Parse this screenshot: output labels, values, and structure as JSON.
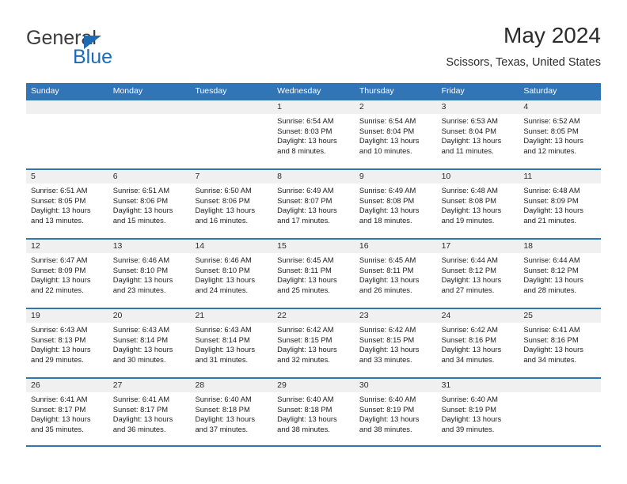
{
  "brand": {
    "name_part1": "General",
    "name_part2": "Blue",
    "triangle_color": "#1b6cb5"
  },
  "header": {
    "title": "May 2024",
    "location": "Scissors, Texas, United States"
  },
  "theme": {
    "header_blue": "#3275b7",
    "date_band_gray": "#f0f0f0",
    "text_color": "#1c1c1c"
  },
  "weekdays": [
    "Sunday",
    "Monday",
    "Tuesday",
    "Wednesday",
    "Thursday",
    "Friday",
    "Saturday"
  ],
  "labels": {
    "sunrise_prefix": "Sunrise:",
    "sunset_prefix": "Sunset:",
    "daylight_prefix": "Daylight:"
  },
  "weeks": [
    [
      {
        "day": "",
        "empty": true
      },
      {
        "day": "",
        "empty": true
      },
      {
        "day": "",
        "empty": true
      },
      {
        "day": "1",
        "sunrise": "Sunrise: 6:54 AM",
        "sunset": "Sunset: 8:03 PM",
        "daylight_a": "Daylight: 13 hours",
        "daylight_b": "and 8 minutes."
      },
      {
        "day": "2",
        "sunrise": "Sunrise: 6:54 AM",
        "sunset": "Sunset: 8:04 PM",
        "daylight_a": "Daylight: 13 hours",
        "daylight_b": "and 10 minutes."
      },
      {
        "day": "3",
        "sunrise": "Sunrise: 6:53 AM",
        "sunset": "Sunset: 8:04 PM",
        "daylight_a": "Daylight: 13 hours",
        "daylight_b": "and 11 minutes."
      },
      {
        "day": "4",
        "sunrise": "Sunrise: 6:52 AM",
        "sunset": "Sunset: 8:05 PM",
        "daylight_a": "Daylight: 13 hours",
        "daylight_b": "and 12 minutes."
      }
    ],
    [
      {
        "day": "5",
        "sunrise": "Sunrise: 6:51 AM",
        "sunset": "Sunset: 8:05 PM",
        "daylight_a": "Daylight: 13 hours",
        "daylight_b": "and 13 minutes."
      },
      {
        "day": "6",
        "sunrise": "Sunrise: 6:51 AM",
        "sunset": "Sunset: 8:06 PM",
        "daylight_a": "Daylight: 13 hours",
        "daylight_b": "and 15 minutes."
      },
      {
        "day": "7",
        "sunrise": "Sunrise: 6:50 AM",
        "sunset": "Sunset: 8:06 PM",
        "daylight_a": "Daylight: 13 hours",
        "daylight_b": "and 16 minutes."
      },
      {
        "day": "8",
        "sunrise": "Sunrise: 6:49 AM",
        "sunset": "Sunset: 8:07 PM",
        "daylight_a": "Daylight: 13 hours",
        "daylight_b": "and 17 minutes."
      },
      {
        "day": "9",
        "sunrise": "Sunrise: 6:49 AM",
        "sunset": "Sunset: 8:08 PM",
        "daylight_a": "Daylight: 13 hours",
        "daylight_b": "and 18 minutes."
      },
      {
        "day": "10",
        "sunrise": "Sunrise: 6:48 AM",
        "sunset": "Sunset: 8:08 PM",
        "daylight_a": "Daylight: 13 hours",
        "daylight_b": "and 19 minutes."
      },
      {
        "day": "11",
        "sunrise": "Sunrise: 6:48 AM",
        "sunset": "Sunset: 8:09 PM",
        "daylight_a": "Daylight: 13 hours",
        "daylight_b": "and 21 minutes."
      }
    ],
    [
      {
        "day": "12",
        "sunrise": "Sunrise: 6:47 AM",
        "sunset": "Sunset: 8:09 PM",
        "daylight_a": "Daylight: 13 hours",
        "daylight_b": "and 22 minutes."
      },
      {
        "day": "13",
        "sunrise": "Sunrise: 6:46 AM",
        "sunset": "Sunset: 8:10 PM",
        "daylight_a": "Daylight: 13 hours",
        "daylight_b": "and 23 minutes."
      },
      {
        "day": "14",
        "sunrise": "Sunrise: 6:46 AM",
        "sunset": "Sunset: 8:10 PM",
        "daylight_a": "Daylight: 13 hours",
        "daylight_b": "and 24 minutes."
      },
      {
        "day": "15",
        "sunrise": "Sunrise: 6:45 AM",
        "sunset": "Sunset: 8:11 PM",
        "daylight_a": "Daylight: 13 hours",
        "daylight_b": "and 25 minutes."
      },
      {
        "day": "16",
        "sunrise": "Sunrise: 6:45 AM",
        "sunset": "Sunset: 8:11 PM",
        "daylight_a": "Daylight: 13 hours",
        "daylight_b": "and 26 minutes."
      },
      {
        "day": "17",
        "sunrise": "Sunrise: 6:44 AM",
        "sunset": "Sunset: 8:12 PM",
        "daylight_a": "Daylight: 13 hours",
        "daylight_b": "and 27 minutes."
      },
      {
        "day": "18",
        "sunrise": "Sunrise: 6:44 AM",
        "sunset": "Sunset: 8:12 PM",
        "daylight_a": "Daylight: 13 hours",
        "daylight_b": "and 28 minutes."
      }
    ],
    [
      {
        "day": "19",
        "sunrise": "Sunrise: 6:43 AM",
        "sunset": "Sunset: 8:13 PM",
        "daylight_a": "Daylight: 13 hours",
        "daylight_b": "and 29 minutes."
      },
      {
        "day": "20",
        "sunrise": "Sunrise: 6:43 AM",
        "sunset": "Sunset: 8:14 PM",
        "daylight_a": "Daylight: 13 hours",
        "daylight_b": "and 30 minutes."
      },
      {
        "day": "21",
        "sunrise": "Sunrise: 6:43 AM",
        "sunset": "Sunset: 8:14 PM",
        "daylight_a": "Daylight: 13 hours",
        "daylight_b": "and 31 minutes."
      },
      {
        "day": "22",
        "sunrise": "Sunrise: 6:42 AM",
        "sunset": "Sunset: 8:15 PM",
        "daylight_a": "Daylight: 13 hours",
        "daylight_b": "and 32 minutes."
      },
      {
        "day": "23",
        "sunrise": "Sunrise: 6:42 AM",
        "sunset": "Sunset: 8:15 PM",
        "daylight_a": "Daylight: 13 hours",
        "daylight_b": "and 33 minutes."
      },
      {
        "day": "24",
        "sunrise": "Sunrise: 6:42 AM",
        "sunset": "Sunset: 8:16 PM",
        "daylight_a": "Daylight: 13 hours",
        "daylight_b": "and 34 minutes."
      },
      {
        "day": "25",
        "sunrise": "Sunrise: 6:41 AM",
        "sunset": "Sunset: 8:16 PM",
        "daylight_a": "Daylight: 13 hours",
        "daylight_b": "and 34 minutes."
      }
    ],
    [
      {
        "day": "26",
        "sunrise": "Sunrise: 6:41 AM",
        "sunset": "Sunset: 8:17 PM",
        "daylight_a": "Daylight: 13 hours",
        "daylight_b": "and 35 minutes."
      },
      {
        "day": "27",
        "sunrise": "Sunrise: 6:41 AM",
        "sunset": "Sunset: 8:17 PM",
        "daylight_a": "Daylight: 13 hours",
        "daylight_b": "and 36 minutes."
      },
      {
        "day": "28",
        "sunrise": "Sunrise: 6:40 AM",
        "sunset": "Sunset: 8:18 PM",
        "daylight_a": "Daylight: 13 hours",
        "daylight_b": "and 37 minutes."
      },
      {
        "day": "29",
        "sunrise": "Sunrise: 6:40 AM",
        "sunset": "Sunset: 8:18 PM",
        "daylight_a": "Daylight: 13 hours",
        "daylight_b": "and 38 minutes."
      },
      {
        "day": "30",
        "sunrise": "Sunrise: 6:40 AM",
        "sunset": "Sunset: 8:19 PM",
        "daylight_a": "Daylight: 13 hours",
        "daylight_b": "and 38 minutes."
      },
      {
        "day": "31",
        "sunrise": "Sunrise: 6:40 AM",
        "sunset": "Sunset: 8:19 PM",
        "daylight_a": "Daylight: 13 hours",
        "daylight_b": "and 39 minutes."
      },
      {
        "day": "",
        "empty": true
      }
    ]
  ]
}
